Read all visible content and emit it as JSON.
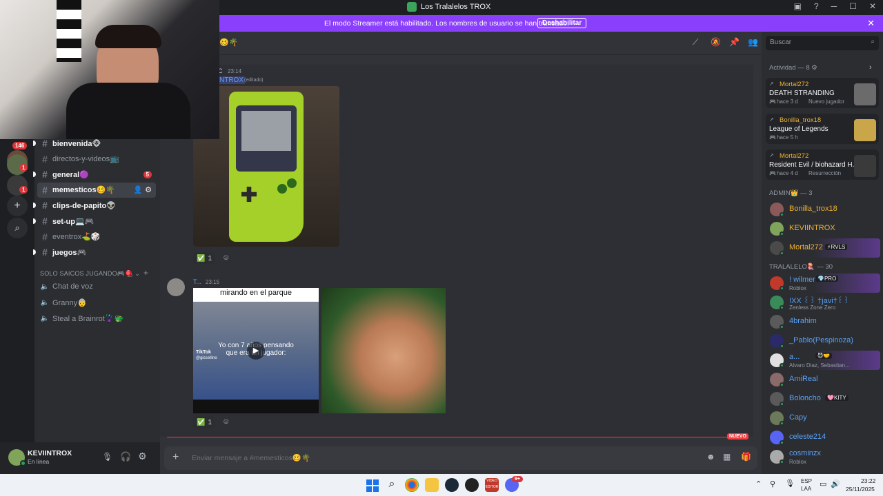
{
  "window": {
    "title": "Los Tralalelos TROX",
    "min_glyph": "─",
    "max_glyph": "☐",
    "close_glyph": "✕"
  },
  "banner": {
    "text": "El modo Streamer está habilitado. Los nombres de usuario se han truncado.",
    "button": "Deshabilitar",
    "close": "✕",
    "color": "#8a3ffc"
  },
  "servers": {
    "badges": [
      "146",
      "1",
      "1"
    ],
    "add": "+",
    "explore": "⌕"
  },
  "channels": [
    {
      "name": "bienvenida🐵",
      "state": "unread"
    },
    {
      "name": "directos-y-videos📺",
      "state": "normal"
    },
    {
      "name": "general🟣",
      "state": "unread",
      "badge": "5"
    },
    {
      "name": "memesticos🥴🌴",
      "state": "selected"
    },
    {
      "name": "clips-de-papito👽",
      "state": "unread"
    },
    {
      "name": "set-up💻🎮",
      "state": "unread"
    },
    {
      "name": "eventrox⛳🎲",
      "state": "normal"
    },
    {
      "name": "juegos🎮",
      "state": "unread"
    }
  ],
  "voice_category": {
    "label": "SOLO SAICOS JUGANDO🎮🪀",
    "channels": [
      "Chat de voz",
      "Granny👵",
      "Steal a Brainrot🦹🐲"
    ]
  },
  "user": {
    "name": "KEVIINTROX",
    "status": "En línea"
  },
  "header": {
    "channel": "🥴🌴",
    "search_placeholder": "Buscar"
  },
  "messages": [
    {
      "author_trunc": "C",
      "time": "23:14",
      "line2": "NTROX",
      "edited": "(editado)",
      "reaction_count": "1"
    },
    {
      "author_trunc": "T...",
      "time": "23:15",
      "video_caption_top": "mirando en el parque",
      "video_caption": "Yo con 7 años pensando que era un jugador:",
      "tiktok": "TikTok",
      "tiktok_user": "@gissellino",
      "reaction_count": "1"
    }
  ],
  "new_label": "NUEVO",
  "composer": {
    "placeholder": "Enviar mensaje a #memesticos🥴🌴"
  },
  "activity": {
    "title": "Actividad — 8",
    "items": [
      {
        "user": "Mortal272",
        "game": "DEATH STRANDING",
        "time": "hace 3 d",
        "extra": "Nuevo jugador"
      },
      {
        "user": "Bonilla_trox18",
        "game": "League of Legends",
        "time": "hace 5 h",
        "extra": ""
      },
      {
        "user": "Mortal272",
        "game": "Resident Evil / biohazard H...",
        "time": "hace 4 d",
        "extra": "Resurrección"
      }
    ]
  },
  "groups": [
    {
      "label": "ADMIN👑 — 3",
      "members": [
        {
          "name": "Bonilla_trox18",
          "color": "#f0b232",
          "sub": "",
          "tag": ""
        },
        {
          "name": "KEVIINTROX",
          "color": "#f0b232",
          "sub": "",
          "tag": ""
        },
        {
          "name": "Mortal272",
          "color": "#f0b232",
          "sub": "",
          "tag": "⚡RVLS"
        }
      ]
    },
    {
      "label": "TRALALELO🪼 — 30",
      "members": [
        {
          "name": "! wilmer",
          "color": "#5aa0f2",
          "sub": "Roblox",
          "tag": "💎PRO"
        },
        {
          "name": "!XX ꒰꒱ †javi†꒰꒱",
          "color": "#5aa0f2",
          "sub": "Zenless Zone Zero",
          "tag": ""
        },
        {
          "name": "4brahim",
          "color": "#5aa0f2",
          "sub": "",
          "tag": ""
        },
        {
          "name": "_Pablo(Pespinoza)",
          "color": "#5aa0f2",
          "sub": "",
          "tag": ""
        },
        {
          "name": "a...",
          "color": "#5aa0f2",
          "sub": "Alvaro Diaz, Sebastian...",
          "tag": "😈🤝"
        },
        {
          "name": "AmiReal",
          "color": "#5aa0f2",
          "sub": "",
          "tag": ""
        },
        {
          "name": "Boloncho",
          "color": "#5aa0f2",
          "sub": "",
          "tag": "🩷KITY"
        },
        {
          "name": "Capy",
          "color": "#5aa0f2",
          "sub": "",
          "tag": ""
        },
        {
          "name": "celeste214",
          "color": "#5aa0f2",
          "sub": "",
          "tag": ""
        },
        {
          "name": "cosminzx",
          "color": "#5aa0f2",
          "sub": "Roblox",
          "tag": ""
        }
      ]
    }
  ],
  "taskbar": {
    "lang1": "ESP",
    "lang2": "LAA",
    "time": "23:22",
    "date": "25/11/2025",
    "video_badge": "VIDEO EDITOR",
    "discord_badge": "9+"
  }
}
